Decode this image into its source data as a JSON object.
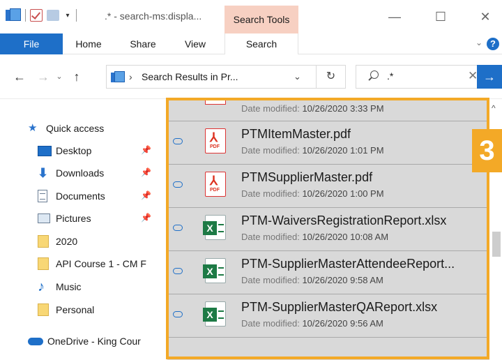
{
  "titlebar": {
    "title": ".* - search-ms:displa...",
    "context_tab": "Search Tools",
    "minimize": "—",
    "maximize": "☐",
    "close": "✕"
  },
  "ribbon": {
    "tabs": [
      "File",
      "Home",
      "Share",
      "View",
      "Search"
    ],
    "help": "?"
  },
  "address": {
    "path": "Search Results in Pr...",
    "search_value": ".*"
  },
  "nav": {
    "items": [
      {
        "label": "Quick access",
        "icon": "star-icon"
      },
      {
        "label": "Desktop",
        "icon": "desktop-icon",
        "pinned": true
      },
      {
        "label": "Downloads",
        "icon": "download-icon",
        "pinned": true
      },
      {
        "label": "Documents",
        "icon": "documents-icon",
        "pinned": true
      },
      {
        "label": "Pictures",
        "icon": "pictures-icon",
        "pinned": true
      },
      {
        "label": "2020",
        "icon": "folder-icon"
      },
      {
        "label": "API Course 1 - CM F",
        "icon": "folder-icon"
      },
      {
        "label": "Music",
        "icon": "music-icon"
      },
      {
        "label": "Personal",
        "icon": "folder-icon"
      },
      {
        "label": "OneDrive - King Cour",
        "icon": "onedrive-cloud-icon"
      }
    ]
  },
  "results": {
    "date_label": "Date modified:",
    "partial_date": "10/26/2020 3:33 PM",
    "files": [
      {
        "name": "PTMItemMaster.pdf",
        "date": "10/26/2020 1:01 PM",
        "type": "pdf"
      },
      {
        "name": "PTMSupplierMaster.pdf",
        "date": "10/26/2020 1:00 PM",
        "type": "pdf"
      },
      {
        "name": "PTM-WaiversRegistrationReport.xlsx",
        "date": "10/26/2020 10:08 AM",
        "type": "xlsx"
      },
      {
        "name": "PTM-SupplierMasterAttendeeReport...",
        "date": "10/26/2020 9:58 AM",
        "type": "xlsx"
      },
      {
        "name": "PTM-SupplierMasterQAReport.xlsx",
        "date": "10/26/2020 9:56 AM",
        "type": "xlsx"
      }
    ]
  },
  "callout": {
    "number": "3",
    "color": "#f3a927"
  },
  "colors": {
    "accent": "#1e6fc8",
    "context_tab": "#f7d0c2",
    "selection": "#d9d9d9"
  }
}
